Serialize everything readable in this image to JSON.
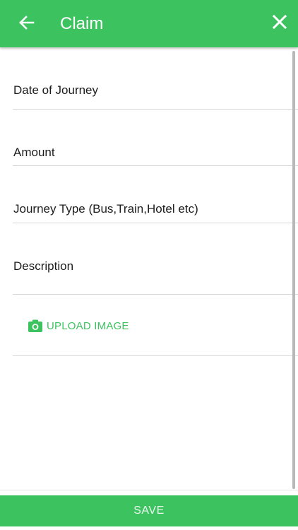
{
  "app_bar": {
    "title": "Claim",
    "back_icon": "arrow-back-icon",
    "close_icon": "close-icon",
    "color": "#3cc35f"
  },
  "form": {
    "fields": [
      {
        "label": "Date of Journey"
      },
      {
        "label": "Amount"
      },
      {
        "label": "Journey Type (Bus,Train,Hotel etc)"
      },
      {
        "label": "Description"
      }
    ],
    "upload": {
      "label": "UPLOAD IMAGE",
      "icon": "camera-icon"
    }
  },
  "footer": {
    "save_label": "SAVE"
  },
  "colors": {
    "accent": "#3cc35f",
    "text": "#1c1c1c",
    "divider": "#d6d6d6"
  }
}
